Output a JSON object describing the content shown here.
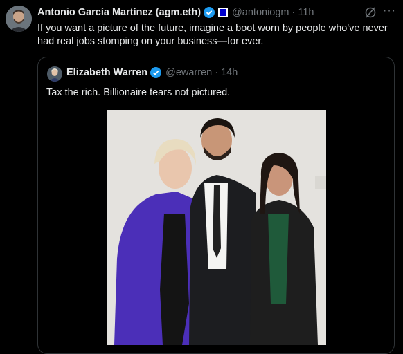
{
  "tweet": {
    "author_name": "Antonio García Martínez (agm.eth)",
    "handle": "@antoniogm",
    "separator": "·",
    "time": "11h",
    "text": "If you want a picture of the future, imagine a boot worn by people who've never had real jobs stomping on your business—for ever.",
    "more_glyph": "···"
  },
  "quoted_tweet": {
    "author_name": "Elizabeth Warren",
    "handle": "@ewarren",
    "separator": "·",
    "time": "14h",
    "text": "Tax the rich. Billionaire tears not pictured."
  },
  "colors": {
    "background": "#000000",
    "text": "#e7e9ea",
    "muted": "#71767b",
    "verified_blue": "#1d9bf0",
    "border": "#2f3336"
  },
  "icons": [
    "verified-badge-icon",
    "affiliate-badge-icon",
    "grok-icon",
    "more-icon"
  ]
}
